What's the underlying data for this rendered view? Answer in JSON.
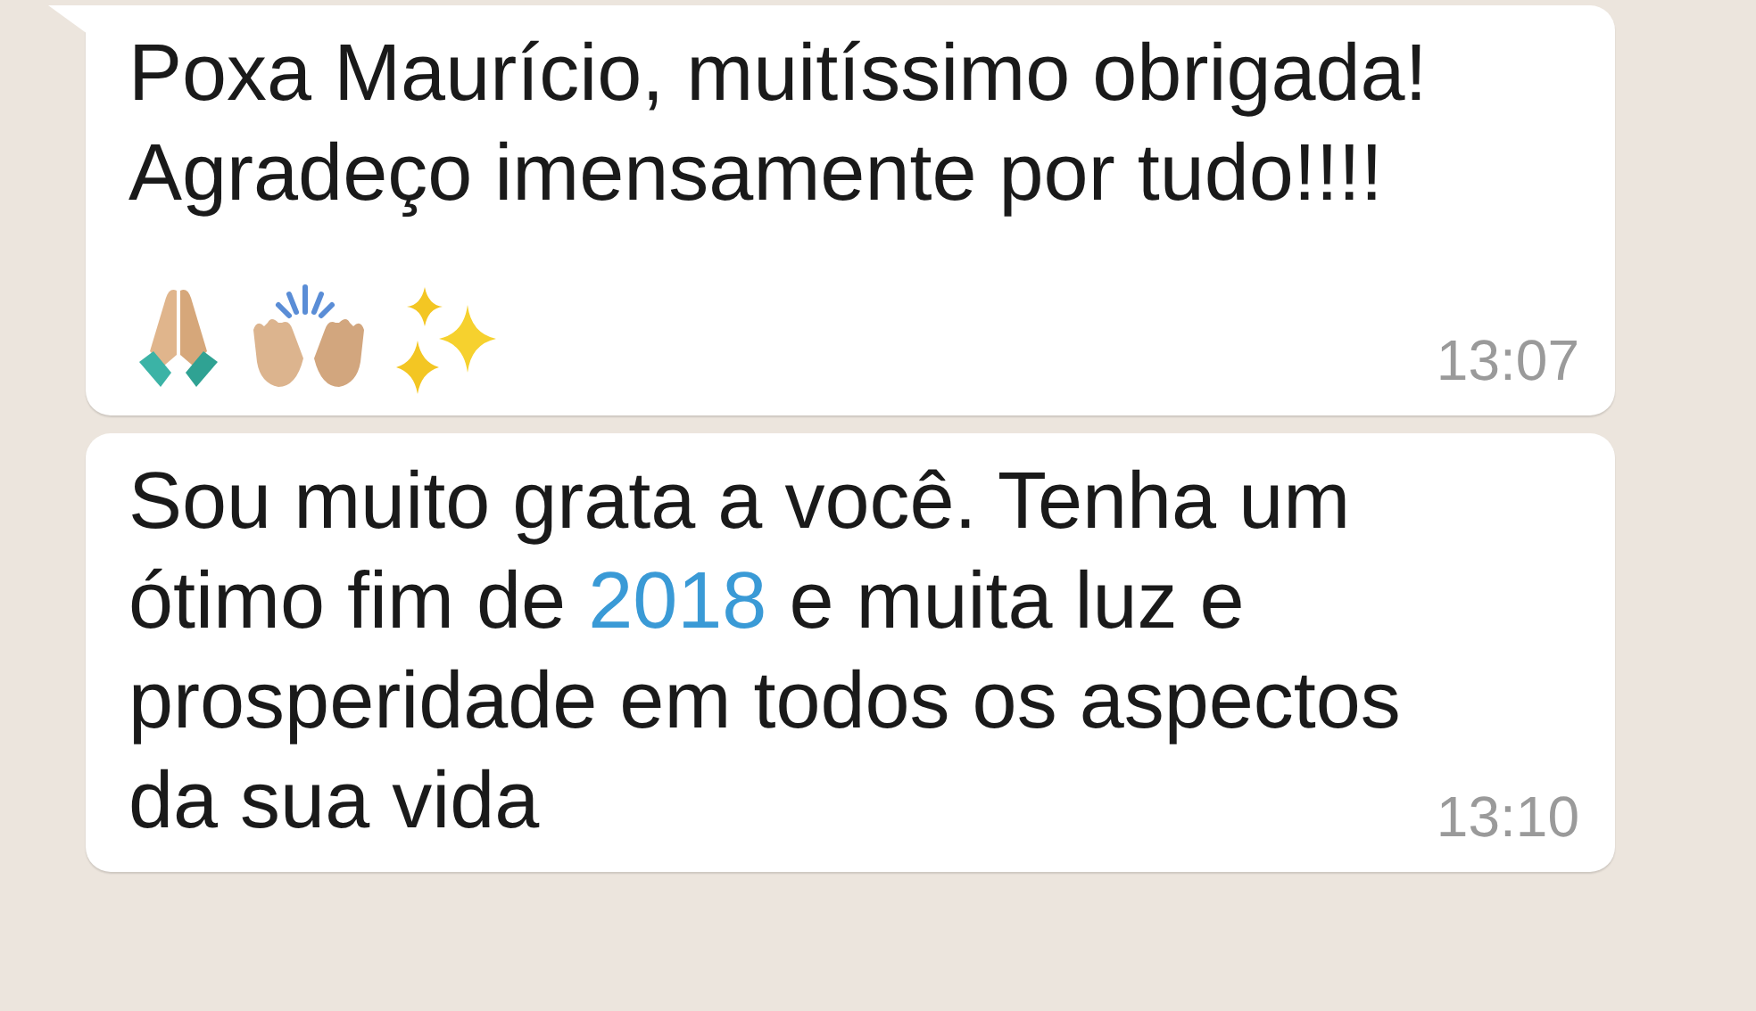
{
  "messages": [
    {
      "lines": [
        [
          {
            "kind": "text",
            "text": "Poxa Maurício, muitíssimo obrigada!"
          }
        ],
        [
          {
            "kind": "text",
            "text": "Agradeço imensamente por tudo!!!!"
          }
        ]
      ],
      "emoji": [
        {
          "kind": "pray"
        },
        {
          "kind": "raise"
        },
        {
          "kind": "sparkle"
        }
      ],
      "time": "13:07",
      "tail": true
    },
    {
      "lines": [
        [
          {
            "kind": "text",
            "text": "Sou muito grata a você. Tenha um"
          }
        ],
        [
          {
            "kind": "text",
            "text": "ótimo fim de "
          },
          {
            "kind": "link",
            "text": "2018"
          },
          {
            "kind": "text",
            "text": " e muita luz e"
          }
        ],
        [
          {
            "kind": "text",
            "text": "prosperidade em todos os aspectos"
          }
        ],
        [
          {
            "kind": "text",
            "text": "da sua vida"
          }
        ]
      ],
      "time": "13:10",
      "tail": false
    }
  ]
}
